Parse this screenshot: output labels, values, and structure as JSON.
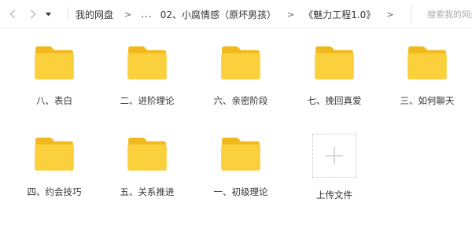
{
  "toolbar": {
    "back_icon": "chevron-left-icon",
    "forward_icon": "chevron-right-icon",
    "history_icon": "caret-down-icon",
    "breadcrumb": {
      "root": "我的网盘",
      "ellipsis": "...",
      "parent": "02、小腐情感（原坏男孩）",
      "current": "《魅力工程1.0》",
      "separator": ">"
    },
    "search_placeholder": "搜索我的网盘"
  },
  "items": [
    {
      "label": "八、表白",
      "type": "folder"
    },
    {
      "label": "二、进阶理论",
      "type": "folder"
    },
    {
      "label": "六、亲密阶段",
      "type": "folder"
    },
    {
      "label": "七、挽回真爱",
      "type": "folder"
    },
    {
      "label": "三、如何聊天",
      "type": "folder"
    },
    {
      "label": "四、约会技巧",
      "type": "folder"
    },
    {
      "label": "五、关系推进",
      "type": "folder"
    },
    {
      "label": "一、初级理论",
      "type": "folder"
    },
    {
      "label": "上传文件",
      "type": "upload"
    }
  ],
  "colors": {
    "folder_back": "#f2b91c",
    "folder_front": "#fbd03d",
    "text": "#333333",
    "upload_plus": "#cccccc"
  }
}
